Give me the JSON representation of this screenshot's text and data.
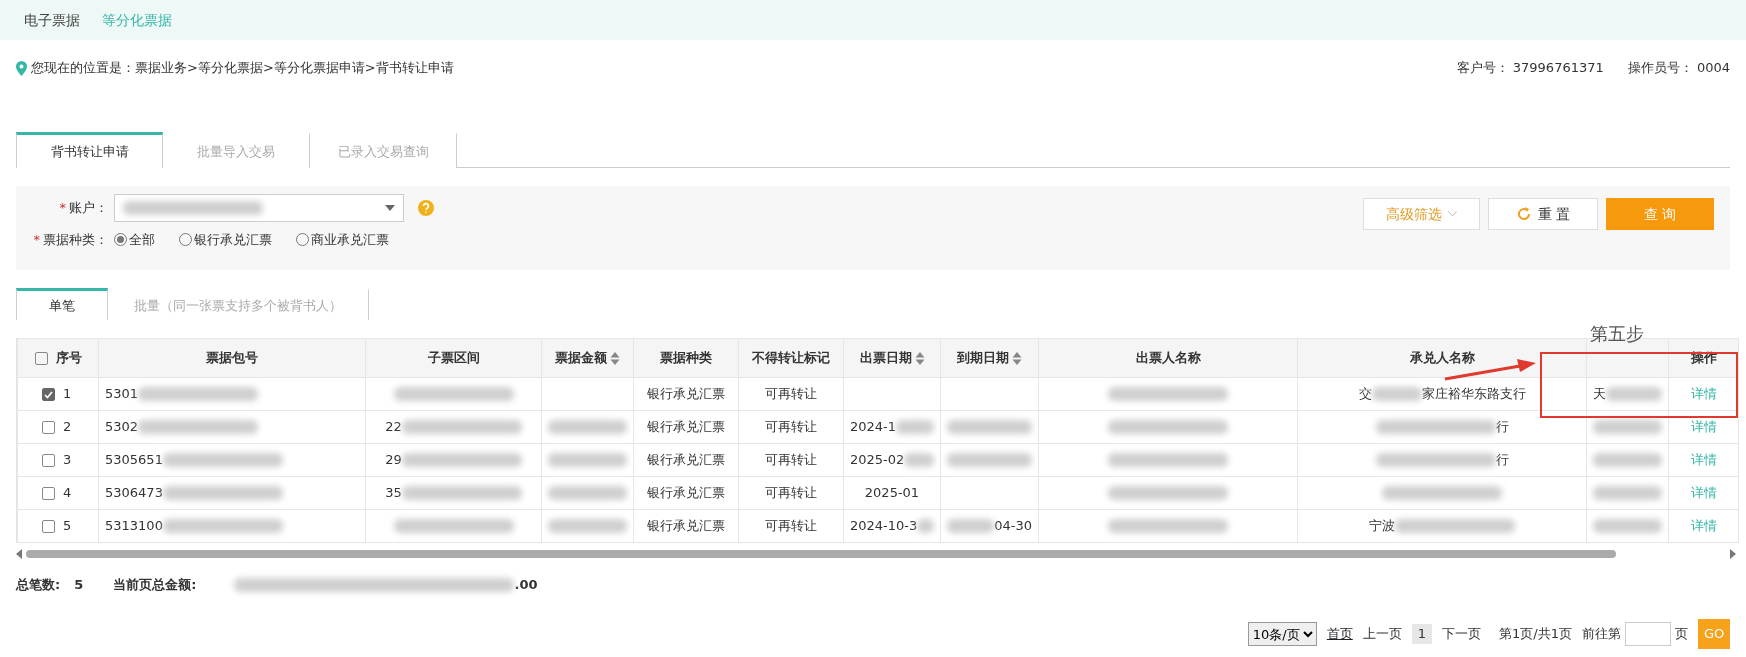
{
  "top_nav": [
    {
      "label": "电子票据",
      "selected": false
    },
    {
      "label": "等分化票据",
      "selected": true
    }
  ],
  "breadcrumb": "您现在的位置是：票据业务>等分化票据>等分化票据申请>背书转让申请",
  "customer": {
    "label": "客户号：",
    "value": "37996761371"
  },
  "operator": {
    "label": "操作员号：",
    "value": "0004"
  },
  "tabs": [
    {
      "label": "背书转让申请",
      "selected": true
    },
    {
      "label": "批量导入交易",
      "selected": false
    },
    {
      "label": "已录入交易查询",
      "selected": false
    }
  ],
  "filters": {
    "account_mark": "*",
    "account_label": "账户：",
    "account_blurred": true,
    "ticket_type_mark": "*",
    "ticket_type_label": "票据种类：",
    "ticket_types": [
      {
        "label": "全部",
        "selected": true
      },
      {
        "label": "银行承兑汇票",
        "selected": false
      },
      {
        "label": "商业承兑汇票",
        "selected": false
      }
    ],
    "buttons": [
      {
        "kind": "advanced",
        "label": "高级筛选"
      },
      {
        "kind": "reset",
        "label": "重 置"
      },
      {
        "kind": "query",
        "label": "查 询"
      }
    ]
  },
  "sub_tabs": [
    {
      "label": "单笔",
      "selected": true
    },
    {
      "label": "批量（同一张票支持多个被背书人）",
      "selected": false
    }
  ],
  "table": {
    "select_all_checked": false,
    "columns": [
      {
        "label": "序号",
        "sortable": false
      },
      {
        "label": "票据包号",
        "sortable": false
      },
      {
        "label": "子票区间",
        "sortable": false
      },
      {
        "label": "票据金额",
        "sortable": true
      },
      {
        "label": "票据种类",
        "sortable": false
      },
      {
        "label": "不得转让标记",
        "sortable": false
      },
      {
        "label": "出票日期",
        "sortable": true
      },
      {
        "label": "到期日期",
        "sortable": true
      },
      {
        "label": "出票人名称",
        "sortable": false
      },
      {
        "label": "承兑人名称",
        "sortable": false
      },
      {
        "sortable": false
      },
      {
        "label": "操作",
        "sortable": false
      }
    ],
    "rows": [
      {
        "checked": true,
        "cells": [
          {
            "text": "1"
          },
          {
            "text": "5301",
            "blurred": true
          },
          {
            "text": "",
            "blurred": true
          },
          {
            "text": "",
            "blurred": false
          },
          {
            "text": "银行承兑汇票"
          },
          {
            "text": "可再转让"
          },
          {
            "text": ""
          },
          {
            "text": ""
          },
          {
            "text": "",
            "blurred": true
          },
          {
            "text": "交",
            "blurred": true,
            "end": "家庄裕华东路支行"
          },
          {
            "text": "天",
            "blurred": true
          }
        ],
        "action": "详情"
      },
      {
        "checked": false,
        "cells": [
          {
            "text": "2"
          },
          {
            "text": "5302",
            "blurred": true
          },
          {
            "text": "22",
            "blurred": true
          },
          {
            "text": "",
            "blurred": true
          },
          {
            "text": "银行承兑汇票"
          },
          {
            "text": "可再转让"
          },
          {
            "text": "2024-1",
            "blurred": true
          },
          {
            "text": "",
            "blurred": true
          },
          {
            "text": "",
            "blurred": true
          },
          {
            "text": "",
            "blurred": true,
            "end": "行"
          },
          {
            "text": "",
            "blurred": true
          }
        ],
        "action": "详情"
      },
      {
        "checked": false,
        "cells": [
          {
            "text": "3"
          },
          {
            "text": "5305651",
            "blurred": true
          },
          {
            "text": "29",
            "blurred": true
          },
          {
            "text": "",
            "blurred": true
          },
          {
            "text": "银行承兑汇票"
          },
          {
            "text": "可再转让"
          },
          {
            "text": "2025-02",
            "blurred": true
          },
          {
            "text": "",
            "blurred": true
          },
          {
            "text": "",
            "blurred": true
          },
          {
            "text": "",
            "blurred": true,
            "end": "行"
          },
          {
            "text": "",
            "blurred": true
          }
        ],
        "action": "详情"
      },
      {
        "checked": false,
        "cells": [
          {
            "text": "4"
          },
          {
            "text": "5306473",
            "blurred": true
          },
          {
            "text": "35",
            "blurred": true
          },
          {
            "text": "",
            "blurred": true
          },
          {
            "text": "银行承兑汇票"
          },
          {
            "text": "可再转让"
          },
          {
            "text": "2025-01"
          },
          {
            "text": ""
          },
          {
            "text": "",
            "blurred": true
          },
          {
            "text": "",
            "blurred": true
          },
          {
            "text": "",
            "blurred": true
          }
        ],
        "action": "详情"
      },
      {
        "checked": false,
        "cells": [
          {
            "text": "5"
          },
          {
            "text": "5313100",
            "blurred": true
          },
          {
            "text": "",
            "blurred": true
          },
          {
            "text": "",
            "blurred": true
          },
          {
            "text": "银行承兑汇票"
          },
          {
            "text": "可再转让"
          },
          {
            "text": "2024-10-3",
            "blurred": true
          },
          {
            "text": "",
            "blurred": true,
            "end": "04-30"
          },
          {
            "text": "",
            "blurred": true
          },
          {
            "text": "宁波",
            "blurred": true
          },
          {
            "text": "",
            "blurred": true
          }
        ],
        "action": "详情"
      }
    ]
  },
  "totals": {
    "count_label": "总笔数:",
    "count": "5",
    "amount_label": "当前页总金额:",
    "amount_end": ".00"
  },
  "pagination": {
    "page_size": "10条/页",
    "first": "首页",
    "prev": "上一页",
    "current": "1",
    "next": "下一页",
    "info": "第1页/共1页",
    "goto_label": "前往第",
    "goto_unit": "页",
    "go": "GO"
  },
  "annotation": {
    "label": "第五步"
  }
}
